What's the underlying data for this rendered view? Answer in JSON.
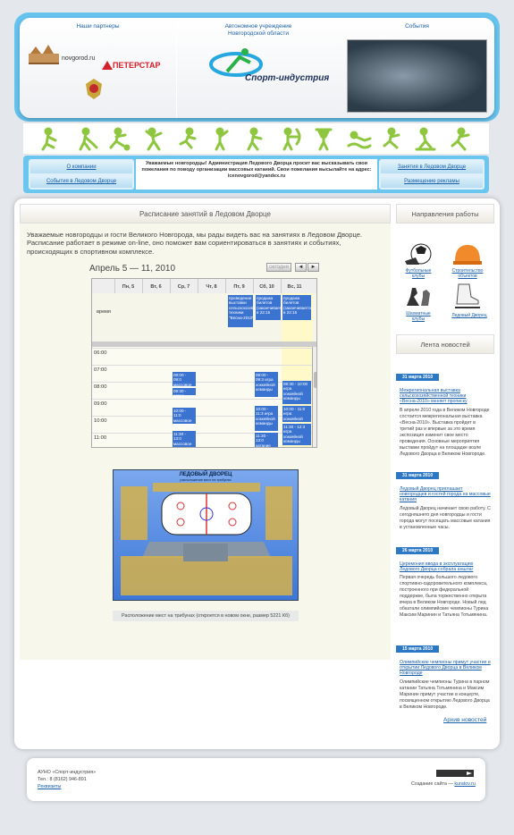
{
  "header": {
    "partners_title": "Наши партнеры",
    "org_title_line1": "Автономное учреждение",
    "org_title_line2": "Новгородской области",
    "events_title": "События",
    "logo_name": "Спорт-индустрия",
    "partner_novgorod": "novgorod.ru",
    "partner_peterstar": "ПЕТЕРСТАР"
  },
  "info_bar": {
    "left_link_1": "О компании",
    "left_link_2": "События в Ледовом Дворце",
    "right_link_1": "Занятия в Ледовом Дворце",
    "right_link_2": "Размещение рекламы",
    "notice": "Уважаемые новгородцы! Администрация Ледового Дворца просит вас высказывать свои пожелания по поводу организации массовых катаний. Свои пожелания высылайте на адрес: icenovgorod@yandex.ru"
  },
  "main": {
    "title": "Расписание занятий в Ледовом Дворце",
    "intro": "Уважаемые новгородцы и гости Великого Новгорода, мы рады видеть вас на занятиях в Ледовом Дворце. Расписание работает в режиме on-line, оно поможет вам сориентироваться в занятиях и событиях, происходящих в спортивном комплексе.",
    "schedule_title": "Апрель 5 — 11, 2010",
    "today_label": "сегодня",
    "prev_label": "◄",
    "next_label": "►",
    "allday_label": "время",
    "days": [
      "Пн, 5",
      "Вт, 6",
      "Ср, 7",
      "Чт, 8",
      "Пт, 9",
      "Сб, 10",
      "Вс, 11"
    ],
    "times": [
      "06:00",
      "07:00",
      "08:00",
      "09:00",
      "10:00",
      "11:00",
      "12:00"
    ],
    "allday_events": [
      {
        "text": "проведение выставки сельскохозяйственной техники \"Весна-2010\""
      },
      {
        "text": "продажа билетов (заканчивается в 22:15"
      },
      {
        "text": "продажа билетов (заканчивается в 22:15"
      }
    ],
    "events": [
      {
        "day": "wed",
        "text": "08:00 - 09:0 массовое катание"
      },
      {
        "day": "wed",
        "text": "09:30 - катал"
      },
      {
        "day": "wed",
        "text": "10:00 - 11:0 массовое катание"
      },
      {
        "day": "wed",
        "text": "11:30 - 13:0 массовое катание"
      },
      {
        "day": "sat",
        "text": "08:00 - 09:3 игра хоккейной команды"
      },
      {
        "day": "sat",
        "text": "10:00 - 11:3 игра хоккейной команды"
      },
      {
        "day": "sat",
        "text": "11:30 - 13:0 катание массово"
      },
      {
        "day": "sun",
        "text": "08:30 - 10:00 игра хоккейной команды"
      },
      {
        "day": "sun",
        "text": "10:00 - 11:0 игра хоккейной команды"
      },
      {
        "day": "sun",
        "text": "11:30 - 12:3 игра хоккейной команды"
      }
    ],
    "seatmap_title": "ЛЕДОВЫЙ ДВОРЕЦ",
    "seatmap_subtitle": "расположение мест на трибунах",
    "seatmap_caption": "Расположение мест на трибунах (откроется в новом окне, размер 5221 Кб)"
  },
  "sidebar": {
    "directions_title": "Направления работы",
    "directions": [
      {
        "label": "Футбольные клубы",
        "icon": "football-icon"
      },
      {
        "label": "Строительство объектов",
        "icon": "helmet-icon"
      },
      {
        "label": "Шахматные клубы",
        "icon": "chess-icon"
      },
      {
        "label": "Ледовый Дворец",
        "icon": "skate-icon"
      }
    ],
    "news_title": "Лента новостей",
    "news": [
      {
        "date": "31 марта 2010",
        "title": "Межрегиональная выставка сельскохозяйственной техники «Весна-2010» меняет прописку",
        "text": "В апреле 2010 года в Великом Новгороде состоится межрегиональная выставка «Весна-2010». Выставка пройдет в третий раз и впервые за это время экспозиция изменит свое место проведения. Основные мероприятия выставки пройдут на площадке возле Ледового Дворца в Великом Новгороде."
      },
      {
        "date": "31 марта 2010",
        "title": "Ледовый Дворец приглашает новгородцев и гостей города на массовые катания",
        "text": "Ледовый Дворец начинает свою работу. С сегодняшнего дня новгородцы и гости города могут посещать массовые катания в установленные часы."
      },
      {
        "date": "26 марта 2010",
        "title": "Церемония ввода в эксплуатацию Ледового Дворца собрала аншлаг",
        "text": "Первая очередь большого ледового спортивно-оздоровительного комплекса, построенного при федеральной поддержке, была торжественно открыта вчера в Великом Новгороде. Новый лед обкатали олимпийские чемпионы Турина Максим Маринин и Татьяна Тотьмянина."
      },
      {
        "date": "15 марта 2010",
        "title": "Олимпийские чемпионы примут участие в открытии Ледового Дворца в Великом Новгороде",
        "text": "Олимпийские чемпионы Турина в парном катании Татьяна Тотьмянина и Максим Маринин примут участие в концерте, посвященном открытию Ледового Дворца в Великом Новгороде."
      }
    ],
    "archive_label": "Архив новостей"
  },
  "footer": {
    "org": "АУНО «Спорт-индустрия»",
    "phone": "Тел.: 8 (8162) 946-891",
    "requisites": "Реквизиты",
    "credit": "Создание сайта —",
    "credit_link": "kuratov.ru"
  }
}
